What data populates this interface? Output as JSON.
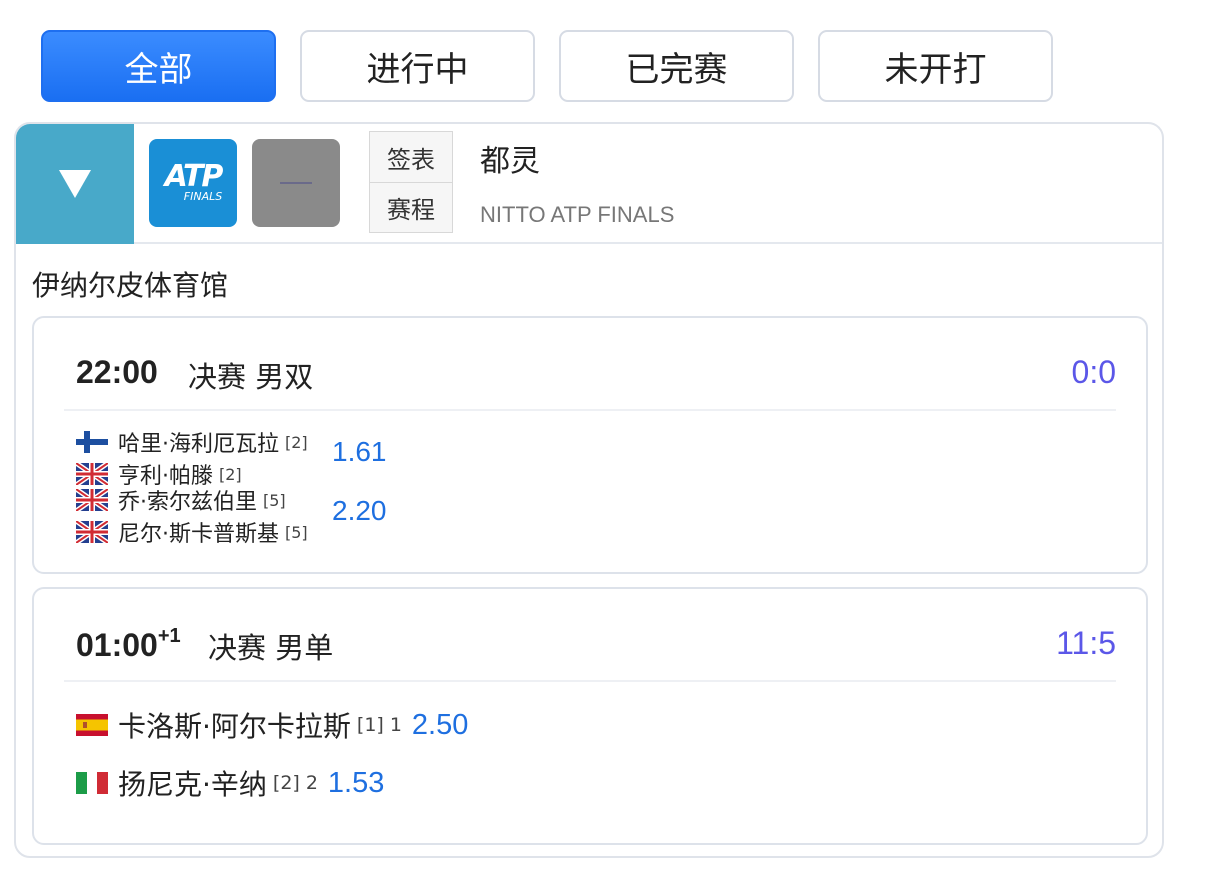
{
  "tabs": [
    {
      "label": "全部",
      "active": true
    },
    {
      "label": "进行中",
      "active": false
    },
    {
      "label": "已完赛",
      "active": false
    },
    {
      "label": "未开打",
      "active": false
    }
  ],
  "event": {
    "collapse_icon": "triangle-down-icon",
    "logo_text": "ATP",
    "logo_subtext": "FINALS",
    "links": [
      "签表",
      "赛程"
    ],
    "city": "都灵",
    "name": "NITTO ATP FINALS",
    "header_color": "#48a9c9"
  },
  "venue": "伊纳尔皮体育馆",
  "matches": [
    {
      "time": "22:00",
      "round": "决赛 男双",
      "score": "0:0",
      "team1": {
        "players": [
          {
            "flag": "finland-flag-icon",
            "name": "哈里·海利厄瓦拉",
            "seed": "[2]"
          },
          {
            "flag": "uk-flag-icon",
            "name": "亨利·帕滕",
            "seed": "[2]"
          }
        ],
        "odds": "1.61"
      },
      "team2": {
        "players": [
          {
            "flag": "uk-flag-icon",
            "name": "乔·索尔兹伯里",
            "seed": "[5]"
          },
          {
            "flag": "uk-flag-icon",
            "name": "尼尔·斯卡普斯基",
            "seed": "[5]"
          }
        ],
        "odds": "2.20"
      }
    },
    {
      "time": "01:00",
      "day_offset": "+1",
      "round": "决赛 男单",
      "score": "11:5",
      "players": [
        {
          "flag": "spain-flag-icon",
          "name": "卡洛斯·阿尔卡拉斯",
          "seed": "[1]",
          "sets": "1",
          "odds": "2.50"
        },
        {
          "flag": "italy-flag-icon",
          "name": "扬尼克·辛纳",
          "seed": "[2]",
          "sets": "2",
          "odds": "1.53"
        }
      ]
    }
  ],
  "colors": {
    "accent": "#1a6ff2",
    "score": "#5b57e8",
    "odds": "#1e6fe0"
  }
}
